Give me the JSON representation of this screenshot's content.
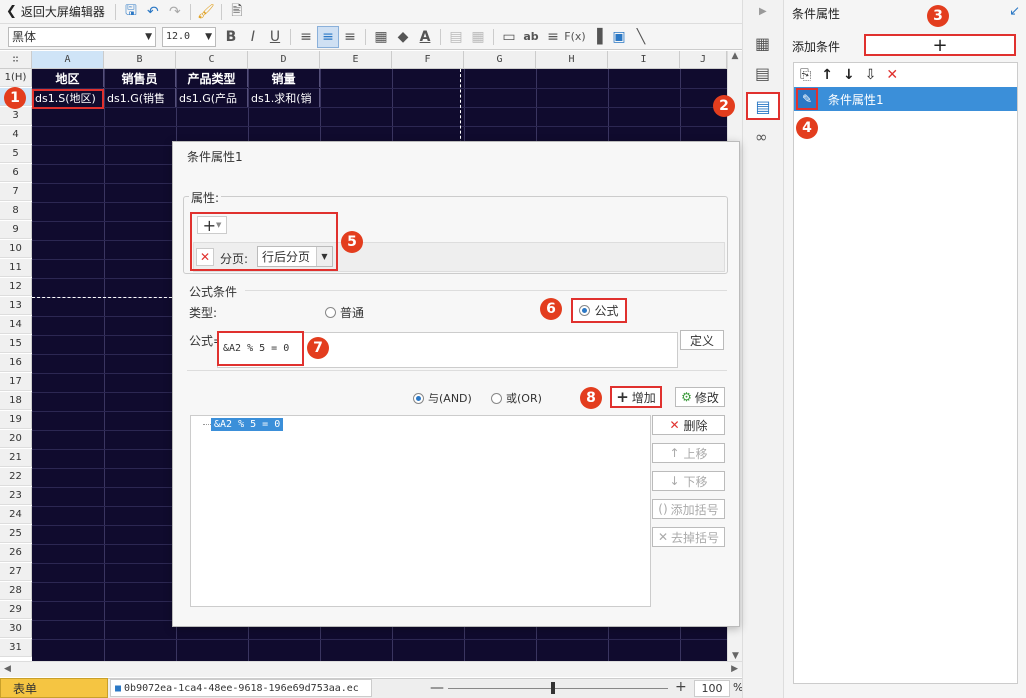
{
  "toolbar": {
    "back_label": "返回大屏编辑器",
    "font_name": "黑体",
    "font_size": "12.0"
  },
  "sheet": {
    "columns": [
      "A",
      "B",
      "C",
      "D",
      "E",
      "F",
      "G",
      "H",
      "I",
      "J"
    ],
    "rows": [
      "1(H)",
      "2",
      "3",
      "4",
      "5",
      "6",
      "7",
      "8",
      "9",
      "10",
      "11",
      "12",
      "13",
      "14",
      "15",
      "16",
      "17",
      "18",
      "19",
      "20",
      "21",
      "22",
      "23",
      "24",
      "25",
      "26",
      "27",
      "28",
      "29",
      "30",
      "31"
    ],
    "header_cells": [
      "地区",
      "销售员",
      "产品类型",
      "销量"
    ],
    "data_cells": [
      "ds1.S(地区)",
      "ds1.G(销售",
      "ds1.G(产品",
      "ds1.求和(销"
    ]
  },
  "bottom": {
    "sheet_tab": "表单",
    "file_name": "0b9072ea-1ca4-48ee-9618-196e69d753aa.ec",
    "zoom": "100",
    "zoom_unit": "%"
  },
  "dialog": {
    "title": "条件属性1",
    "attributes_label": "属性:",
    "paging_label": "分页:",
    "paging_value": "行后分页",
    "formula_section_label": "公式条件",
    "type_label": "类型:",
    "type_normal": "普通",
    "type_formula": "公式",
    "formula_label": "公式=",
    "formula_value": "&A2 % 5 = 0",
    "define_button": "定义",
    "and_label": "与(AND)",
    "or_label": "或(OR)",
    "add_button": "增加",
    "modify_button": "修改",
    "condition_item": "&A2 % 5 = 0",
    "delete_button": "删除",
    "move_up_button": "上移",
    "move_down_button": "下移",
    "add_bracket_button": "添加括号",
    "remove_bracket_button": "去掉括号"
  },
  "right_panel": {
    "title": "条件属性",
    "add_condition_label": "添加条件",
    "add_symbol": "+",
    "list_item": "条件属性1"
  },
  "badges": [
    "1",
    "2",
    "3",
    "4",
    "5",
    "6",
    "7",
    "8"
  ],
  "colors": {
    "accent": "#2b78c5",
    "highlight_red": "#e0312e",
    "badge": "#e33d1e",
    "sheet_bg": "#100b2e"
  }
}
